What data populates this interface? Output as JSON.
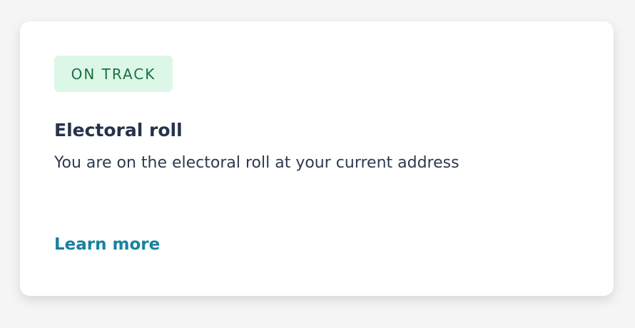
{
  "card": {
    "status_badge": "ON TRACK",
    "title": "Electoral roll",
    "description": "You are on the electoral roll at your current address",
    "link_label": "Learn more"
  },
  "colors": {
    "badge_bg": "#dcf7e8",
    "badge_text": "#19703f",
    "title": "#26334a",
    "link": "#18819f"
  }
}
